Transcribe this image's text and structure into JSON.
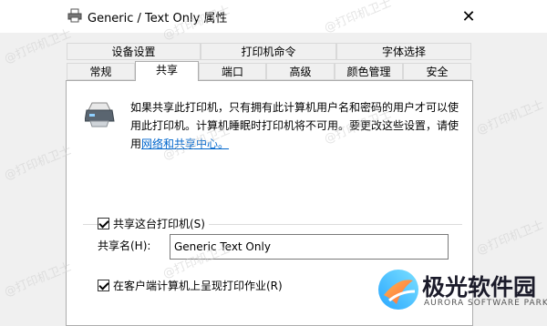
{
  "window": {
    "title": "Generic / Text Only 属性",
    "close_glyph": "✕"
  },
  "tabs_row1": [
    "设备设置",
    "打印机命令",
    "字体选择"
  ],
  "tabs_row2": [
    "常规",
    "共享",
    "端口",
    "高级",
    "颜色管理",
    "安全"
  ],
  "active_tab": "共享",
  "panel": {
    "description": "如果共享此打印机，只有拥有此计算机用户名和密码的用户才可以使用此打印机。计算机睡眠时打印机将不可用。要更改这些设置，请使用",
    "link_text": "网络和共享中心。",
    "share_checkbox": {
      "label": "共享这台打印机(S)",
      "checked": true
    },
    "share_name_label": "共享名(H):",
    "share_name_value": "Generic  Text Only",
    "render_checkbox": {
      "label": "在客户端计算机上呈现打印作业(R)",
      "checked": true
    }
  },
  "watermark_text": "@打印机卫士",
  "brand": {
    "name": "极光软件园",
    "subtitle": "AURORA SOFTWARE PARK"
  },
  "icons": [
    "printer-icon",
    "close-icon",
    "shared-printer-icon",
    "aurora-logo-icon"
  ]
}
